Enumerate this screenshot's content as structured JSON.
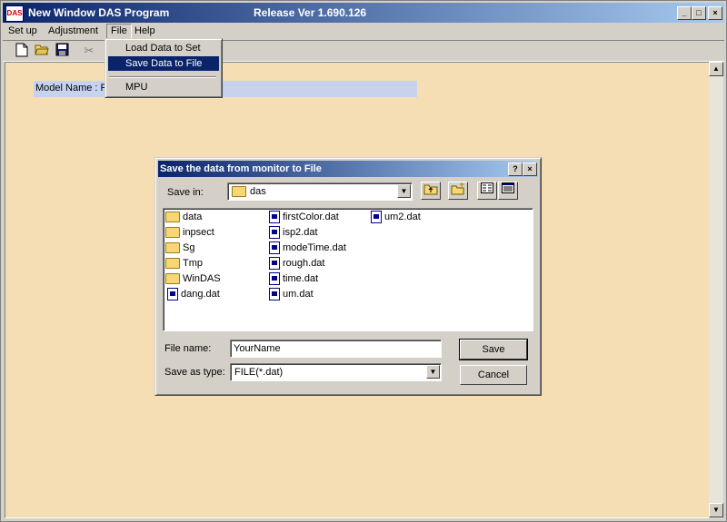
{
  "window": {
    "icon_text": "DAS",
    "title": "New Window DAS Program",
    "version": "Release Ver 1.690.126",
    "min_glyph": "_",
    "max_glyph": "□",
    "close_glyph": "×"
  },
  "menubar": {
    "items": [
      {
        "label": "Set up"
      },
      {
        "label": "Adjustment"
      },
      {
        "label": "File"
      },
      {
        "label": "Help"
      }
    ]
  },
  "file_menu": {
    "items": [
      {
        "label": "Load Data to Set"
      },
      {
        "label": "Save Data to File"
      },
      {
        "label": "MPU"
      }
    ]
  },
  "main": {
    "model_name_label": "Model Name : P"
  },
  "dialog": {
    "title": "Save the data from monitor to File",
    "help_glyph": "?",
    "close_glyph": "×",
    "save_in_label": "Save in:",
    "save_in_value": "das",
    "files": [
      {
        "name": "data",
        "kind": "folder"
      },
      {
        "name": "inpsect",
        "kind": "folder"
      },
      {
        "name": "Sg",
        "kind": "folder"
      },
      {
        "name": "Tmp",
        "kind": "folder"
      },
      {
        "name": "WinDAS",
        "kind": "folder"
      },
      {
        "name": "dang.dat",
        "kind": "file"
      },
      {
        "name": "firstColor.dat",
        "kind": "file"
      },
      {
        "name": "isp2.dat",
        "kind": "file"
      },
      {
        "name": "modeTime.dat",
        "kind": "file"
      },
      {
        "name": "rough.dat",
        "kind": "file"
      },
      {
        "name": "time.dat",
        "kind": "file"
      },
      {
        "name": "um.dat",
        "kind": "file"
      },
      {
        "name": "um2.dat",
        "kind": "file"
      }
    ],
    "file_name_label": "File name:",
    "file_name_value": "YourName",
    "save_as_type_label": "Save as type:",
    "save_as_type_value": "FILE(*.dat)",
    "save_button": "Save",
    "cancel_button": "Cancel"
  },
  "colors": {
    "client_bg": "#f5deb3",
    "title_bar": "#0a246a",
    "menu_highlight": "#0a246a"
  }
}
